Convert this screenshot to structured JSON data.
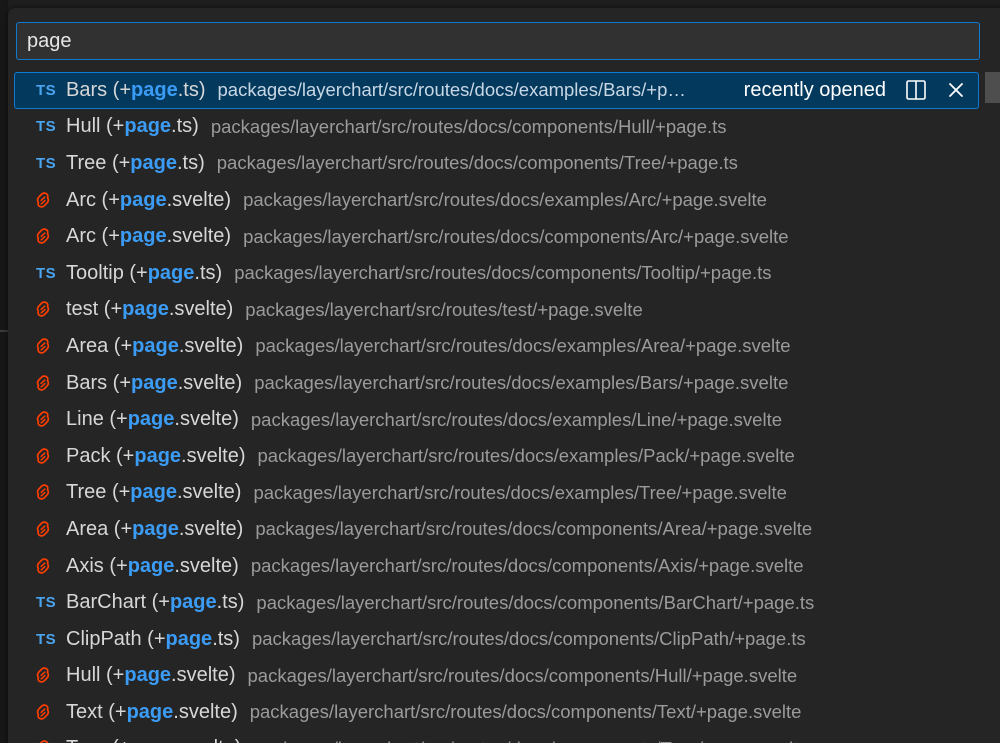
{
  "search": {
    "value": "page",
    "query": "page"
  },
  "selected_row": {
    "recent_label": "recently opened"
  },
  "icons": {
    "ts": "TS",
    "svelte": "svelte-icon"
  },
  "colors": {
    "accent": "#0e7ad3",
    "highlight": "#3b9cf5",
    "ts_icon": "#4aa5f0",
    "svelte_icon": "#ff3e00",
    "selected_bg": "#04395e"
  },
  "results": [
    {
      "type": "ts",
      "pre": "Bars (+",
      "hl": "page",
      "post": ".ts)",
      "path": "packages/layerchart/src/routes/docs/examples/Bars/+page.ts",
      "selected": true
    },
    {
      "type": "ts",
      "pre": "Hull (+",
      "hl": "page",
      "post": ".ts)",
      "path": "packages/layerchart/src/routes/docs/components/Hull/+page.ts"
    },
    {
      "type": "ts",
      "pre": "Tree (+",
      "hl": "page",
      "post": ".ts)",
      "path": "packages/layerchart/src/routes/docs/components/Tree/+page.ts"
    },
    {
      "type": "svelte",
      "pre": "Arc (+",
      "hl": "page",
      "post": ".svelte)",
      "path": "packages/layerchart/src/routes/docs/examples/Arc/+page.svelte"
    },
    {
      "type": "svelte",
      "pre": "Arc (+",
      "hl": "page",
      "post": ".svelte)",
      "path": "packages/layerchart/src/routes/docs/components/Arc/+page.svelte"
    },
    {
      "type": "ts",
      "pre": "Tooltip (+",
      "hl": "page",
      "post": ".ts)",
      "path": "packages/layerchart/src/routes/docs/components/Tooltip/+page.ts"
    },
    {
      "type": "svelte",
      "pre": "test (+",
      "hl": "page",
      "post": ".svelte)",
      "path": "packages/layerchart/src/routes/test/+page.svelte"
    },
    {
      "type": "svelte",
      "pre": "Area (+",
      "hl": "page",
      "post": ".svelte)",
      "path": "packages/layerchart/src/routes/docs/examples/Area/+page.svelte"
    },
    {
      "type": "svelte",
      "pre": "Bars (+",
      "hl": "page",
      "post": ".svelte)",
      "path": "packages/layerchart/src/routes/docs/examples/Bars/+page.svelte"
    },
    {
      "type": "svelte",
      "pre": "Line (+",
      "hl": "page",
      "post": ".svelte)",
      "path": "packages/layerchart/src/routes/docs/examples/Line/+page.svelte"
    },
    {
      "type": "svelte",
      "pre": "Pack (+",
      "hl": "page",
      "post": ".svelte)",
      "path": "packages/layerchart/src/routes/docs/examples/Pack/+page.svelte"
    },
    {
      "type": "svelte",
      "pre": "Tree (+",
      "hl": "page",
      "post": ".svelte)",
      "path": "packages/layerchart/src/routes/docs/examples/Tree/+page.svelte"
    },
    {
      "type": "svelte",
      "pre": "Area (+",
      "hl": "page",
      "post": ".svelte)",
      "path": "packages/layerchart/src/routes/docs/components/Area/+page.svelte"
    },
    {
      "type": "svelte",
      "pre": "Axis (+",
      "hl": "page",
      "post": ".svelte)",
      "path": "packages/layerchart/src/routes/docs/components/Axis/+page.svelte"
    },
    {
      "type": "ts",
      "pre": "BarChart (+",
      "hl": "page",
      "post": ".ts)",
      "path": "packages/layerchart/src/routes/docs/components/BarChart/+page.ts"
    },
    {
      "type": "ts",
      "pre": "ClipPath (+",
      "hl": "page",
      "post": ".ts)",
      "path": "packages/layerchart/src/routes/docs/components/ClipPath/+page.ts"
    },
    {
      "type": "svelte",
      "pre": "Hull (+",
      "hl": "page",
      "post": ".svelte)",
      "path": "packages/layerchart/src/routes/docs/components/Hull/+page.svelte"
    },
    {
      "type": "svelte",
      "pre": "Text (+",
      "hl": "page",
      "post": ".svelte)",
      "path": "packages/layerchart/src/routes/docs/components/Text/+page.svelte"
    },
    {
      "type": "svelte",
      "pre": "Tree (+",
      "hl": "page",
      "post": ".svelte)",
      "path": "packages/layerchart/src/routes/docs/components/Tree/+page.svelte"
    }
  ]
}
